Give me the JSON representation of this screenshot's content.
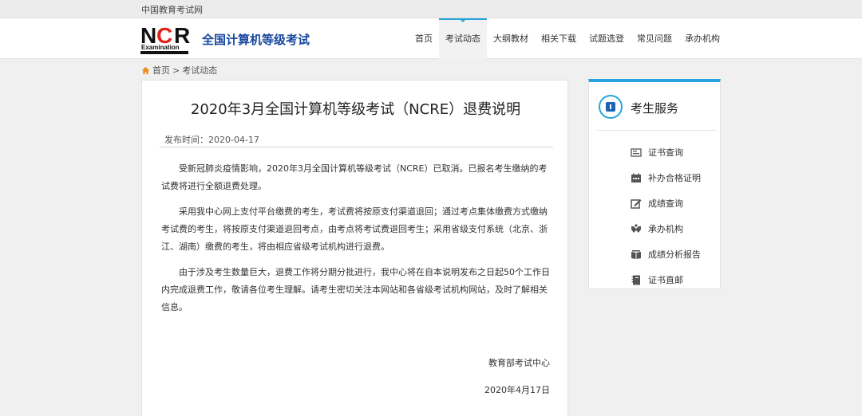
{
  "topbar": {
    "site_name": "中国教育考试网"
  },
  "header": {
    "logo_name": "全国计算机等级考试",
    "nav": [
      {
        "label": "首页",
        "active": false
      },
      {
        "label": "考试动态",
        "active": true
      },
      {
        "label": "大纲教材",
        "active": false
      },
      {
        "label": "相关下载",
        "active": false
      },
      {
        "label": "试题选登",
        "active": false
      },
      {
        "label": "常见问题",
        "active": false
      },
      {
        "label": "承办机构",
        "active": false
      }
    ]
  },
  "breadcrumb": {
    "home": "首页",
    "sep": ">",
    "current": "考试动态"
  },
  "article": {
    "title": "2020年3月全国计算机等级考试（NCRE）退费说明",
    "publish_label": "发布时间：",
    "publish_date": "2020-04-17",
    "paragraphs": [
      "受新冠肺炎疫情影响，2020年3月全国计算机等级考试（NCRE）已取消。已报名考生缴纳的考试费将进行全额退费处理。",
      "采用我中心网上支付平台缴费的考生，考试费将按原支付渠道退回；通过考点集体缴费方式缴纳考试费的考生，将按原支付渠道退回考点，由考点将考试费退回考生；采用省级支付系统（北京、浙江、湖南）缴费的考生，将由相应省级考试机构进行退费。",
      "由于涉及考生数量巨大，退费工作将分期分批进行，我中心将在自本说明发布之日起50个工作日内完成退费工作，敬请各位考生理解。请考生密切关注本网站和各省级考试机构网站，及时了解相关信息。"
    ],
    "signature": "教育部考试中心",
    "sign_date": "2020年4月17日"
  },
  "sidebar": {
    "title": "考生服务",
    "items": [
      {
        "label": "证书查询",
        "icon": "certificate-icon"
      },
      {
        "label": "补办合格证明",
        "icon": "calendar-icon"
      },
      {
        "label": "成绩查询",
        "icon": "edit-icon"
      },
      {
        "label": "承办机构",
        "icon": "handshake-icon"
      },
      {
        "label": "成绩分析报告",
        "icon": "book-icon"
      },
      {
        "label": "证书直邮",
        "icon": "notebook-icon"
      }
    ]
  },
  "colors": {
    "accent": "#29a3dc",
    "logo_blue": "#17479e",
    "logo_red": "#e2231a"
  }
}
